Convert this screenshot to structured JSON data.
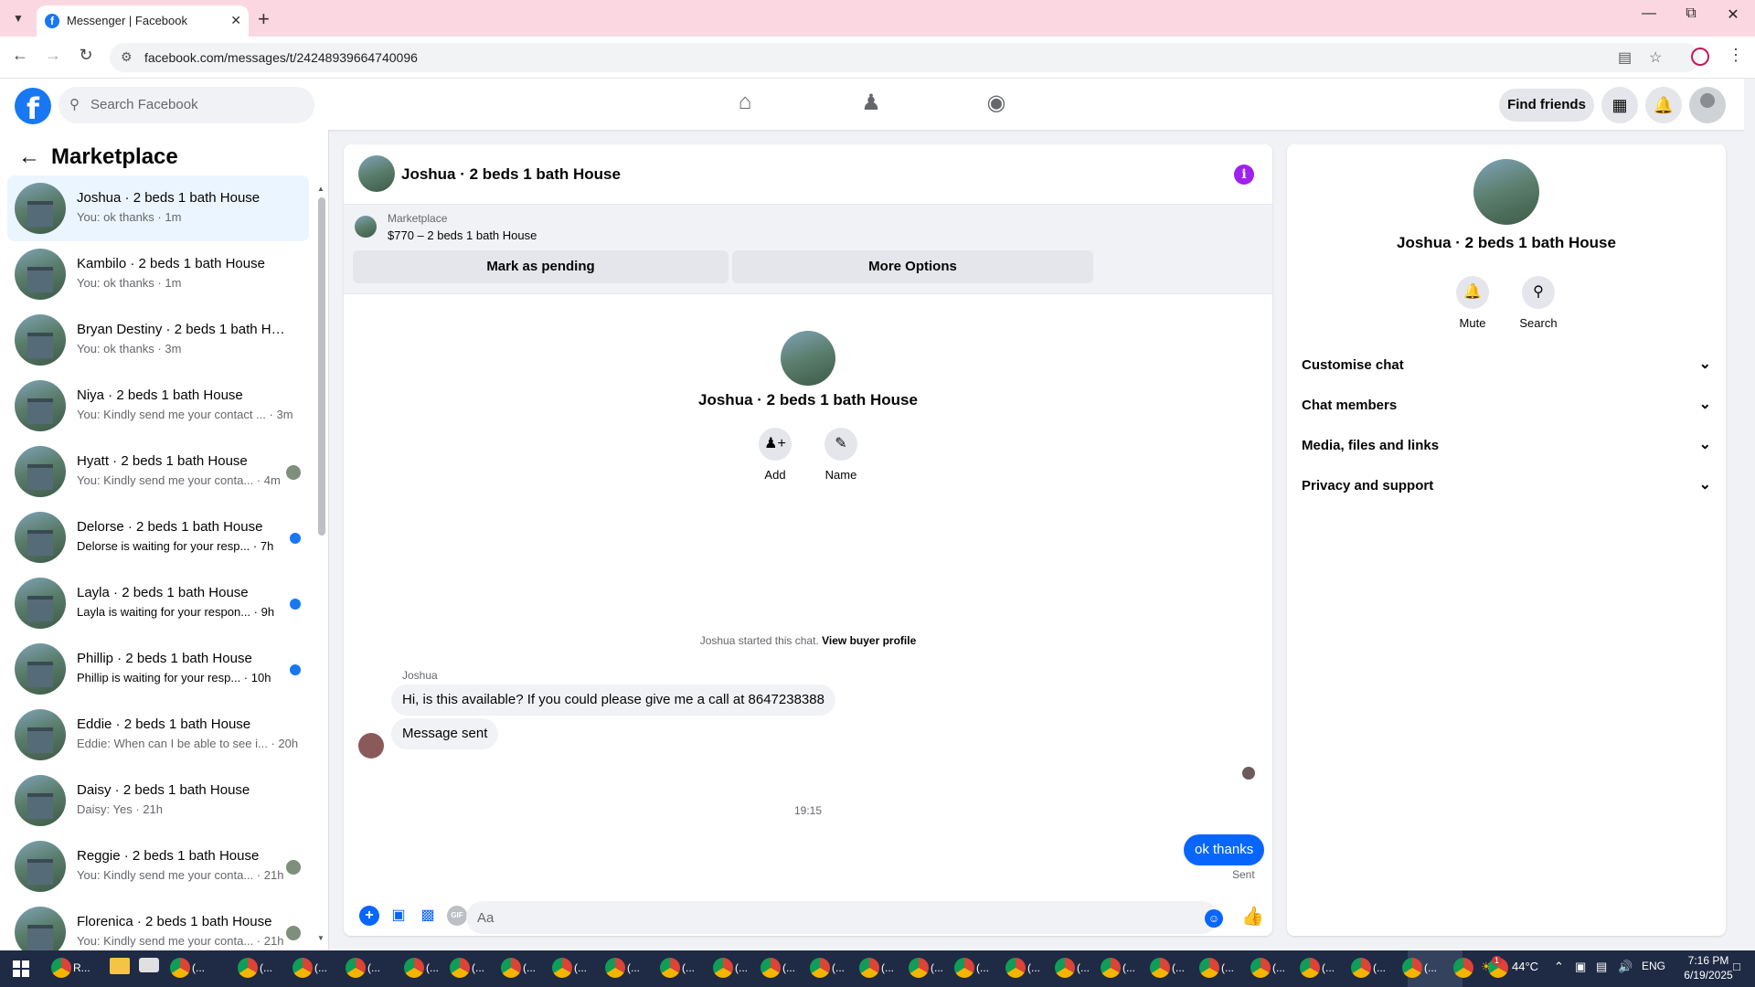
{
  "browser": {
    "tab_title": "Messenger | Facebook",
    "url": "facebook.com/messages/t/24248939664740096",
    "new_tab_symbol": "+",
    "favicon_letter": "f"
  },
  "fbnav": {
    "search_placeholder": "Search Facebook",
    "find_friends": "Find friends",
    "logo_letter": "f"
  },
  "left": {
    "title": "Marketplace",
    "conversations": [
      {
        "name": "Joshua · 2 beds 1 bath House",
        "sub": "You: ok thanks · 1m",
        "active": true,
        "indicator": "none"
      },
      {
        "name": "Kambilo · 2 beds 1 bath House",
        "sub": "You: ok thanks · 1m",
        "indicator": "none"
      },
      {
        "name": "Bryan Destiny · 2 beds 1 bath Ho...",
        "sub": "You: ok thanks · 3m",
        "indicator": "none"
      },
      {
        "name": "Niya · 2 beds 1 bath House",
        "sub": "You: Kindly send me your contact ... · 3m",
        "indicator": "none"
      },
      {
        "name": "Hyatt · 2 beds 1 bath House",
        "sub": "You: Kindly send me your conta... · 4m",
        "indicator": "avatar"
      },
      {
        "name": "Delorse · 2 beds 1 bath House",
        "sub": "Delorse is waiting for your resp... · 7h",
        "indicator": "unread"
      },
      {
        "name": "Layla · 2 beds 1 bath House",
        "sub": "Layla is waiting for your respon... · 9h",
        "indicator": "unread"
      },
      {
        "name": "Phillip · 2 beds 1 bath House",
        "sub": "Phillip is waiting for your resp... · 10h",
        "indicator": "unread"
      },
      {
        "name": "Eddie · 2 beds 1 bath House",
        "sub": "Eddie: When can I be able to see i... · 20h",
        "indicator": "none"
      },
      {
        "name": "Daisy · 2 beds 1 bath House",
        "sub": "Daisy: Yes · 21h",
        "indicator": "none"
      },
      {
        "name": "Reggie · 2 beds 1 bath House",
        "sub": "You: Kindly send me your conta... · 21h",
        "indicator": "avatar"
      },
      {
        "name": "Florenica · 2 beds 1 bath House",
        "sub": "You: Kindly send me your conta... · 21h",
        "indicator": "avatar"
      }
    ]
  },
  "chat": {
    "title": "Joshua · 2 beds 1 bath House",
    "info_symbol": "i",
    "marketplace_label": "Marketplace",
    "listing": "$770 – 2 beds 1 bath House",
    "mark_pending": "Mark as pending",
    "more_options": "More Options",
    "intro_name": "Joshua · 2 beds 1 bath House",
    "add_label": "Add",
    "name_label": "Name",
    "started_text": "Joshua started this chat.",
    "view_buyer": "View buyer profile",
    "sender": "Joshua",
    "messages_in": [
      "Hi, is this available? If you could please give me a call at 8647238388",
      "Message sent"
    ],
    "time_sep": "19:15",
    "message_out": "ok thanks",
    "sent_label": "Sent",
    "composer_placeholder": "Aa",
    "gif_label": "GIF"
  },
  "right": {
    "name": "Joshua · 2 beds 1 bath House",
    "mute": "Mute",
    "search": "Search",
    "sections": [
      "Customise chat",
      "Chat members",
      "Media, files and links",
      "Privacy and support"
    ]
  },
  "taskbar": {
    "first_label": "R...",
    "app_label": "(...",
    "temperature": "44°C",
    "lang": "ENG",
    "time": "7:16 PM",
    "date": "6/19/2025",
    "weather_badge": "1"
  },
  "colors": {
    "fb_blue": "#1877f2",
    "bubble_out": "#0866ff",
    "unread_dot": "#1877f2",
    "info": "#a020f0",
    "tab_strip": "#fbd7e1"
  }
}
